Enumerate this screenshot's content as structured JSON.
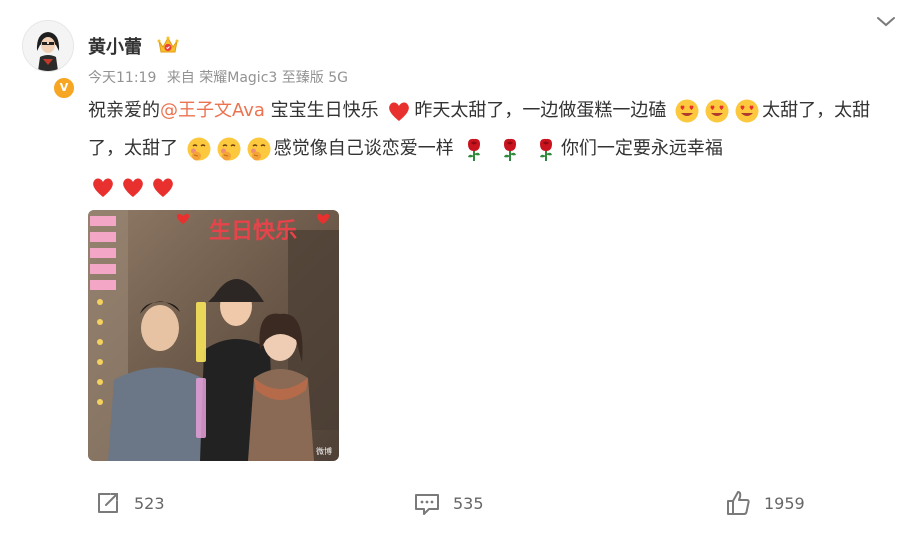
{
  "post": {
    "username": "黄小蕾",
    "time": "今天11:19",
    "source": "来自 荣耀Magic3 至臻版 5G",
    "content": {
      "text1": "祝亲爱的",
      "mention": "@王子文Ava",
      "text2": " 宝宝生日快乐",
      "text3": "昨天太甜了，一边做蛋糕一边磕",
      "text4": "太甜了，太甜了，太甜了",
      "text5": "感觉像自己谈恋爱一样",
      "text6": "你们一定要永远幸福"
    },
    "image": {
      "title": "生日快乐",
      "watermark": "微博"
    }
  },
  "actions": {
    "repost_count": "523",
    "comment_count": "535",
    "like_count": "1959"
  },
  "colors": {
    "mention": "#eb7350",
    "meta": "#939393",
    "vip_badge": "#f6a623"
  },
  "icons": [
    "crown-icon",
    "chevron-down-icon",
    "heart-icon",
    "heart-eyes-icon",
    "blush-icon",
    "rose-icon",
    "repost-icon",
    "comment-icon",
    "like-icon"
  ]
}
